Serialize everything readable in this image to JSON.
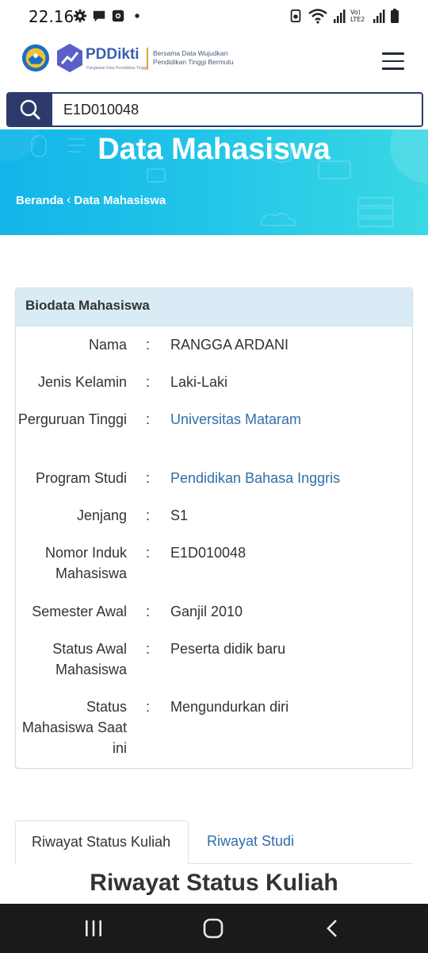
{
  "status_bar": {
    "time": "22.16",
    "network_label": "Vo) LTE2"
  },
  "header": {
    "brand": "PDDikti",
    "brand_sub": "Pangkalan Data Pendidikan Tinggi",
    "tagline_line1": "Bersama Data Wujudkan",
    "tagline_line2": "Pendidikan Tinggi Bermutu"
  },
  "search": {
    "value": "E1D010048",
    "placeholder": ""
  },
  "banner": {
    "title": "Data Mahasiswa",
    "breadcrumb_home": "Beranda",
    "breadcrumb_separator": "‹",
    "breadcrumb_current": "Data Mahasiswa"
  },
  "biodata": {
    "heading": "Biodata Mahasiswa",
    "rows": [
      {
        "label": "Nama",
        "value": "RANGGA ARDANI",
        "link": false
      },
      {
        "label": "Jenis Kelamin",
        "value": "Laki-Laki",
        "link": false
      },
      {
        "label": "Perguruan Tinggi",
        "value": "Universitas Mataram",
        "link": true
      },
      {
        "label": "Program Studi",
        "value": "Pendidikan Bahasa Inggris",
        "link": true
      },
      {
        "label": "Jenjang",
        "value": "S1",
        "link": false
      },
      {
        "label": "Nomor Induk Mahasiswa",
        "value": "E1D010048",
        "link": false
      },
      {
        "label": "Semester Awal",
        "value": "Ganjil 2010",
        "link": false
      },
      {
        "label": "Status Awal Mahasiswa",
        "value": "Peserta didik baru",
        "link": false
      },
      {
        "label": "Status Mahasiswa Saat ini",
        "value": "Mengundurkan diri",
        "link": false
      }
    ]
  },
  "tabs": [
    {
      "label": "Riwayat Status Kuliah",
      "active": true
    },
    {
      "label": "Riwayat Studi",
      "active": false
    }
  ],
  "section_title": "Riwayat Status Kuliah",
  "colors": {
    "primary": "#2c3a6b",
    "banner_start": "#12b5e8",
    "banner_end": "#3ad8e4",
    "link": "#2f6fa8",
    "card_header": "#d9ecf6"
  }
}
